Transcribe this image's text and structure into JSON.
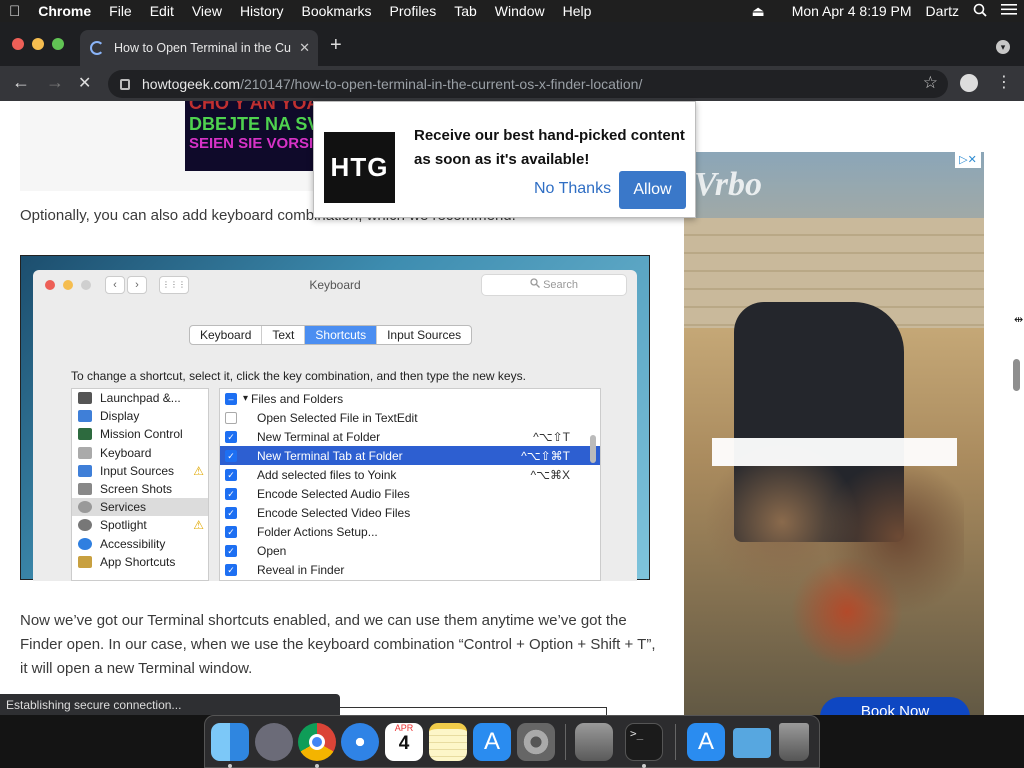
{
  "menubar": {
    "apple": "",
    "app": "Chrome",
    "items": [
      "File",
      "Edit",
      "View",
      "History",
      "Bookmarks",
      "Profiles",
      "Tab",
      "Window",
      "Help"
    ],
    "eject": "⏏",
    "datetime": "Mon Apr 4  8:19 PM",
    "user": "Dartz",
    "search_icon": "search-icon",
    "list_icon": "list-icon"
  },
  "tab": {
    "title": "How to Open Terminal in the Cu",
    "close": "✕",
    "new_tab": "+"
  },
  "toolbar": {
    "back": "←",
    "forward": "→",
    "stop": "✕",
    "url_host": "howtogeek.com",
    "url_path": "/210147/how-to-open-terminal-in-the-current-os-x-finder-location/",
    "star": "☆",
    "menu": "⋮"
  },
  "article": {
    "ad_lines": [
      "CHO Y AN YOAN",
      "DBEJTE NA SV",
      "SEIEN SIE VORSI"
    ],
    "para1": "Optionally, you can also add keyboard combination, which we recommend.",
    "para2": "Now we’ve got our Terminal shortcuts enabled, and we can use them anytime we’ve got the Finder open. In our case, when we use the keyboard combination “Control + Option + Shift + T”, it will open a new Terminal window."
  },
  "keyboard_window": {
    "title": "Keyboard",
    "search": "Search",
    "back": "‹",
    "fwd": "›",
    "grid": "⋮⋮⋮",
    "tabs": [
      {
        "label": "Keyboard",
        "active": false
      },
      {
        "label": "Text",
        "active": false
      },
      {
        "label": "Shortcuts",
        "active": true
      },
      {
        "label": "Input Sources",
        "active": false
      }
    ],
    "instruction": "To change a shortcut, select it, click the key combination, and then type the new keys.",
    "categories": [
      {
        "label": "Launchpad &...",
        "color": "#555",
        "selected": false
      },
      {
        "label": "Display",
        "color": "#3f7fd8",
        "selected": false
      },
      {
        "label": "Mission Control",
        "color": "#2d6a3e",
        "selected": false
      },
      {
        "label": "Keyboard",
        "color": "#aaa",
        "selected": false
      },
      {
        "label": "Input Sources",
        "color": "#3f7fd8",
        "selected": false
      },
      {
        "label": "Screen Shots",
        "color": "#888",
        "selected": false
      },
      {
        "label": "Services",
        "color": "#999",
        "selected": true
      },
      {
        "label": "Spotlight",
        "color": "#777",
        "selected": false
      },
      {
        "label": "Accessibility",
        "color": "#2f7fe0",
        "selected": false
      },
      {
        "label": "App Shortcuts",
        "color": "#c8a040",
        "selected": false
      }
    ],
    "warnings": [
      "⚠",
      "⚠"
    ],
    "shortcuts": [
      {
        "label": "Files and Folders",
        "checked": "minus",
        "shortcut": "",
        "selected": false
      },
      {
        "label": "Open Selected File in TextEdit",
        "checked": "off",
        "shortcut": "",
        "selected": false
      },
      {
        "label": "New Terminal at Folder",
        "checked": "on",
        "shortcut": "^⌥⇧T",
        "selected": false
      },
      {
        "label": "New Terminal Tab at Folder",
        "checked": "on",
        "shortcut": "^⌥⇧⌘T",
        "selected": true
      },
      {
        "label": "Add selected files to Yoink",
        "checked": "on",
        "shortcut": "^⌥⌘X",
        "selected": false
      },
      {
        "label": "Encode Selected Audio Files",
        "checked": "on",
        "shortcut": "",
        "selected": false
      },
      {
        "label": "Encode Selected Video Files",
        "checked": "on",
        "shortcut": "",
        "selected": false
      },
      {
        "label": "Folder Actions Setup...",
        "checked": "on",
        "shortcut": "",
        "selected": false
      },
      {
        "label": "Open",
        "checked": "on",
        "shortcut": "",
        "selected": false
      },
      {
        "label": "Reveal in Finder",
        "checked": "on",
        "shortcut": "",
        "selected": false
      }
    ],
    "group_arrow": "▾",
    "check": "✓",
    "minus": "–"
  },
  "popup": {
    "logo": "HTG",
    "message": "Receive our best hand-picked content as soon as it's available!",
    "no_thanks": "No Thanks",
    "allow": "Allow"
  },
  "sidebar_ad": {
    "logo": "Vrbo",
    "ad_choices": "▷✕",
    "cta": "Book Now"
  },
  "status": "Establishing secure connection...",
  "dock": {
    "apps": [
      {
        "name": "finder-icon",
        "color": "#3b9cf0",
        "running": true
      },
      {
        "name": "launchpad-icon",
        "color": "#6b6b78",
        "running": false
      },
      {
        "name": "chrome-icon",
        "color": "#e0e0e0",
        "running": true
      },
      {
        "name": "safari-icon",
        "color": "#2f83e6",
        "running": false
      },
      {
        "name": "calendar-icon",
        "color": "#ffffff",
        "running": false
      },
      {
        "name": "notes-icon",
        "color": "#f7e070",
        "running": false
      },
      {
        "name": "app-store-icon",
        "color": "#2a8cf0",
        "running": false
      },
      {
        "name": "system-preferences-icon",
        "color": "#8a8a8a",
        "running": false
      },
      {
        "name": "utility-icon",
        "color": "#7a7a7a",
        "running": false
      },
      {
        "name": "terminal-icon",
        "color": "#1b1b1b",
        "running": true
      },
      {
        "name": "app-store-download-icon",
        "color": "#2a8cf0",
        "running": false
      },
      {
        "name": "downloads-folder-icon",
        "color": "#57a7e0",
        "running": false
      },
      {
        "name": "trash-icon",
        "color": "#777777",
        "running": false
      }
    ],
    "calendar": {
      "month": "APR",
      "day": "4"
    }
  }
}
